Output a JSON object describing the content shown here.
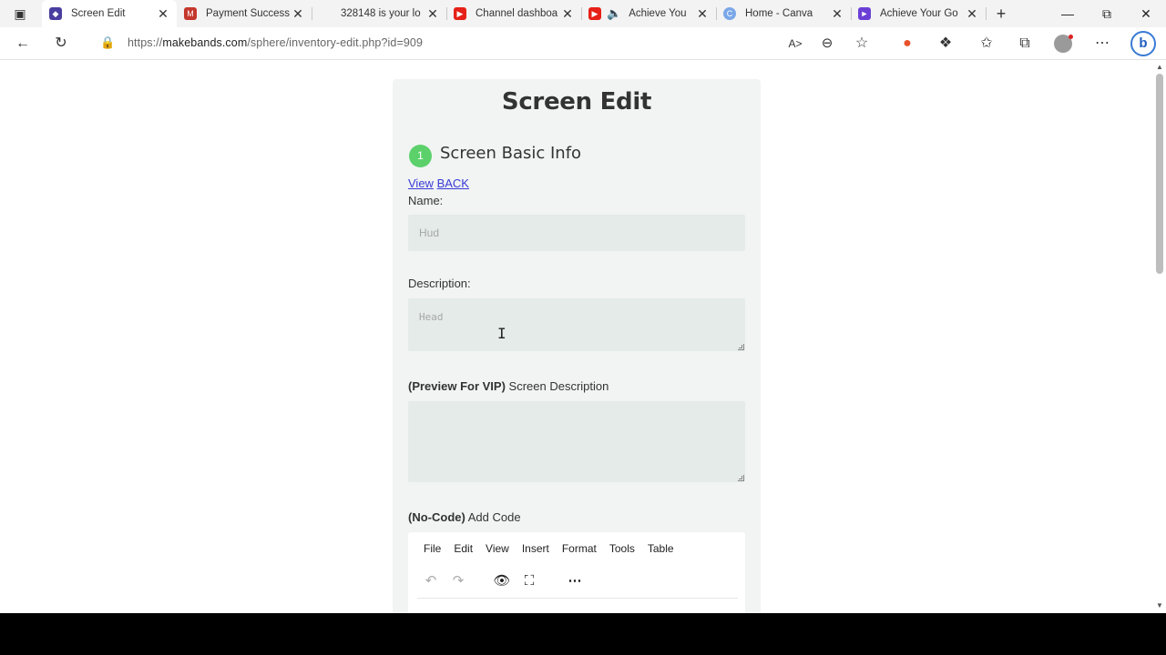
{
  "browser": {
    "tabs": [
      {
        "title": "Screen Edit",
        "icon": "site-favicon",
        "color": "#4a3fa0",
        "active": true
      },
      {
        "title": "Payment Success",
        "icon": "gmail-icon",
        "color": "#c5372c"
      },
      {
        "title": "328148 is your lo",
        "icon": "blank-favicon",
        "color": "#f3f3f3"
      },
      {
        "title": "Channel dashboa",
        "icon": "youtube-icon",
        "color": "#e62117"
      },
      {
        "title": "Achieve You",
        "icon": "youtube-icon",
        "color": "#e62117",
        "audio": true
      },
      {
        "title": "Home - Canva",
        "icon": "canva-icon",
        "color": "#7aa7e8"
      },
      {
        "title": "Achieve Your Go",
        "icon": "video-icon",
        "color": "#6b3fd6"
      }
    ],
    "address": {
      "prefix": "https://",
      "domain": "makebands.com",
      "path": "/sphere/inventory-edit.php?id=909"
    }
  },
  "page": {
    "title": "Screen Edit",
    "step_number": "1",
    "section_title": "Screen Basic Info",
    "links": {
      "view": "View",
      "back": "BACK"
    },
    "name_label": "Name:",
    "name_placeholder": "Hud",
    "description_label": "Description:",
    "description_placeholder": "Head",
    "preview_label_bold": "(Preview For VIP)",
    "preview_label": " Screen Description",
    "code_label_bold": "(No-Code)",
    "code_label": " Add Code",
    "editor_menu": [
      "File",
      "Edit",
      "View",
      "Insert",
      "Format",
      "Tools",
      "Table"
    ]
  },
  "colors": {
    "accent_green": "#5cd16b",
    "link": "#3a3ad6"
  }
}
